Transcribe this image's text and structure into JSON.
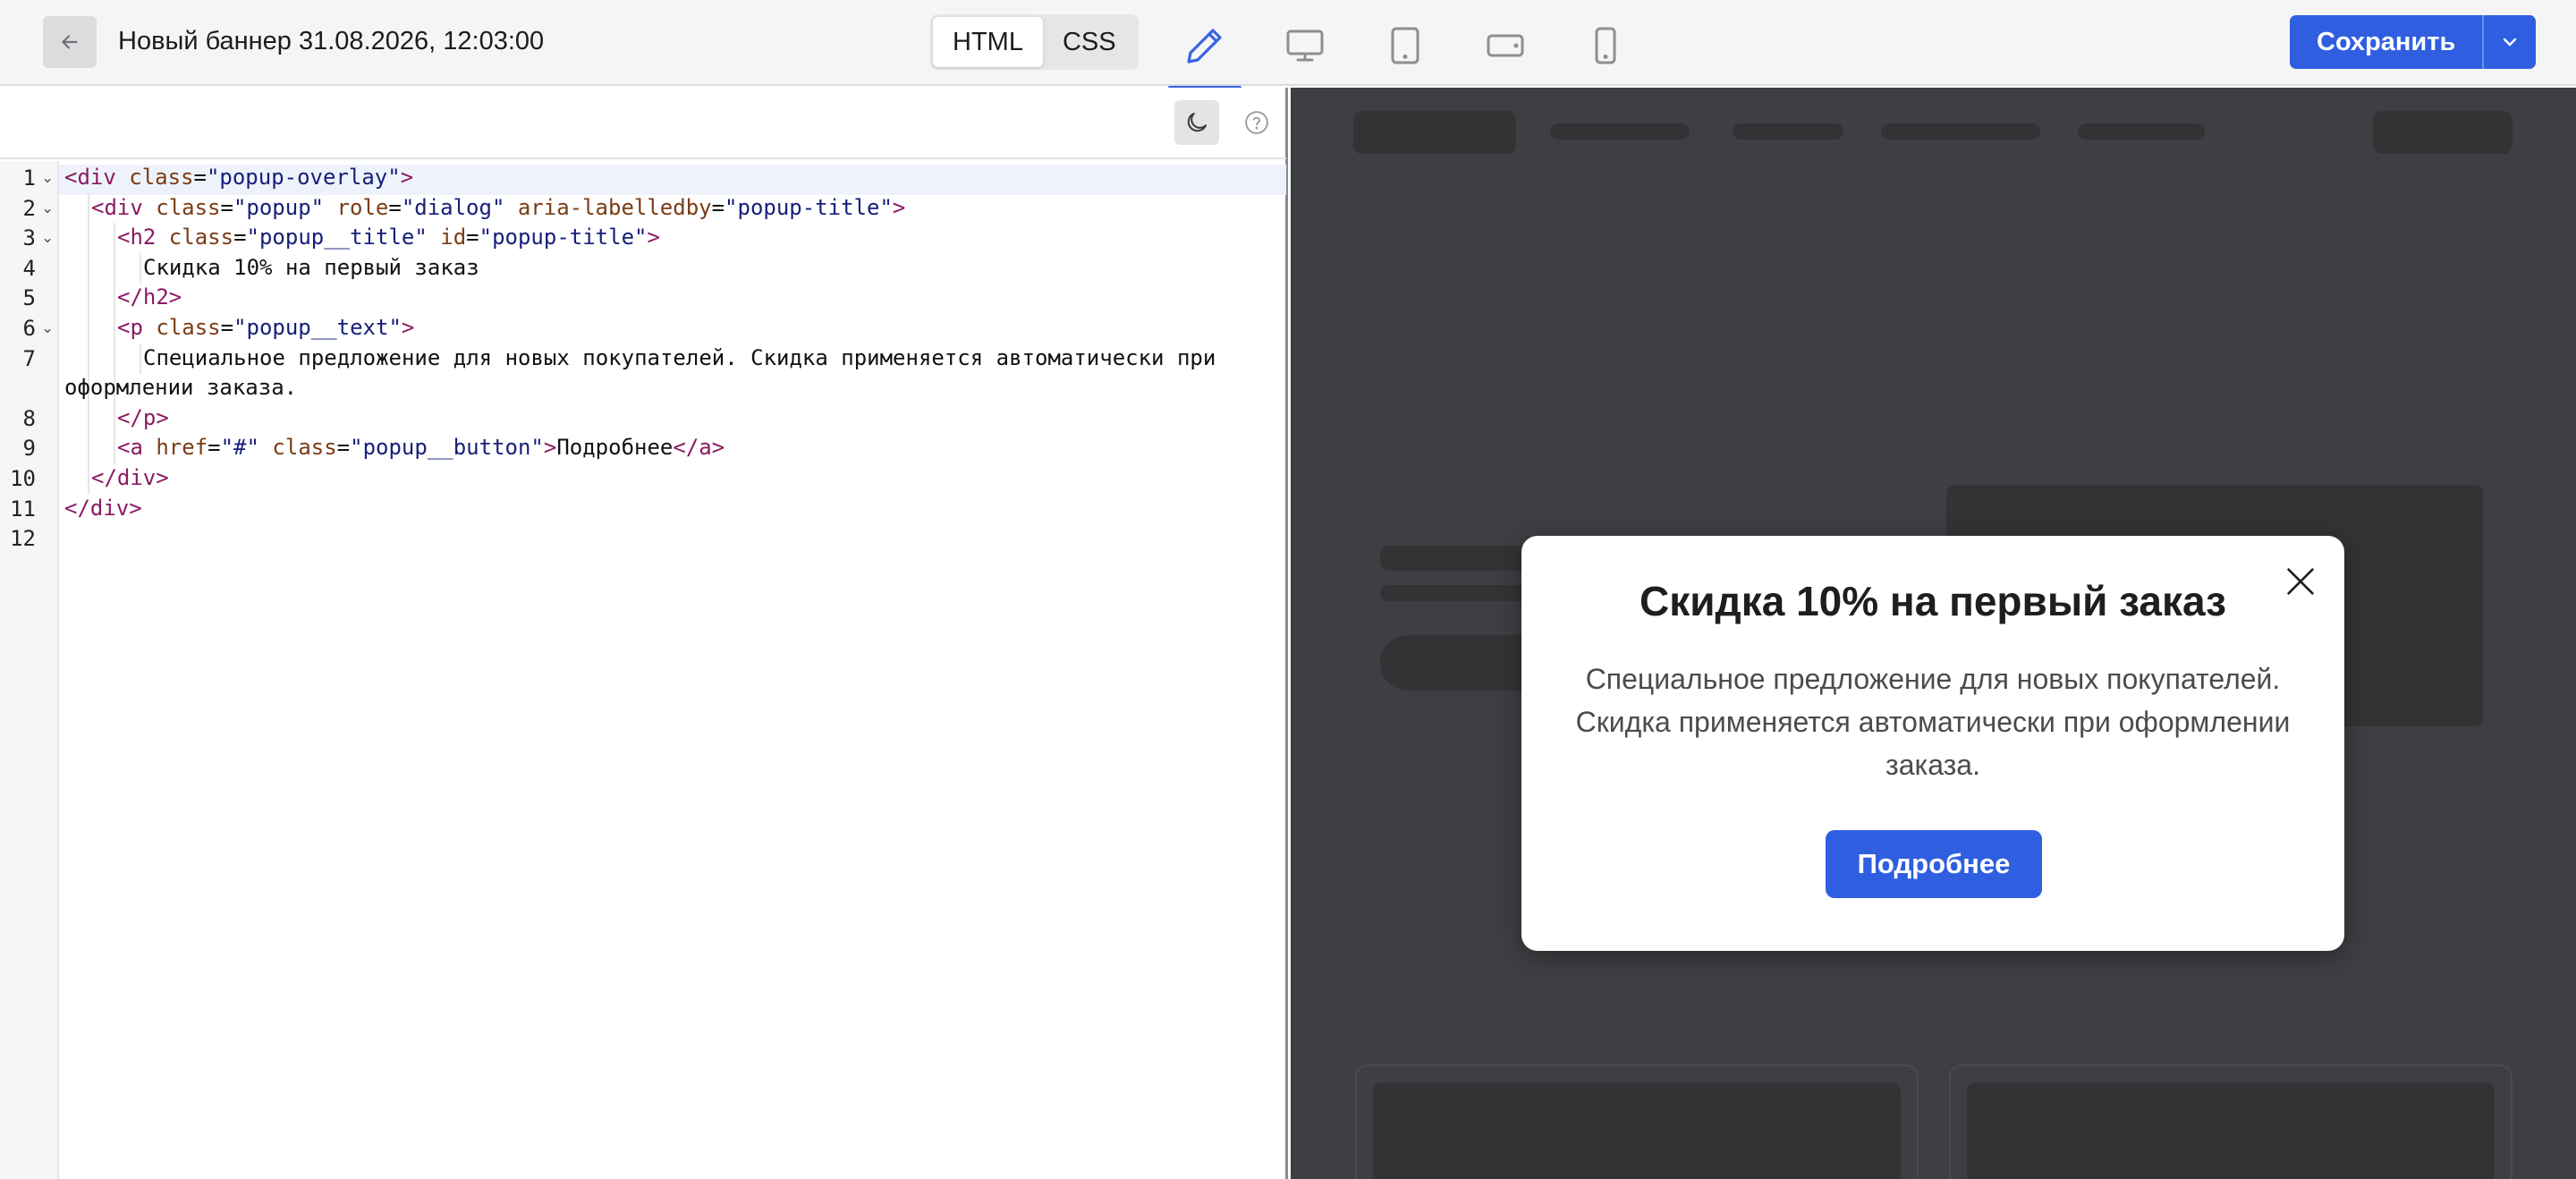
{
  "header": {
    "back_icon": "arrow-left-icon",
    "title": "Новый баннер 31.08.2026, 12:03:00",
    "tabs": [
      {
        "label": "HTML",
        "active": true
      },
      {
        "label": "CSS",
        "active": false
      }
    ],
    "modes": [
      {
        "name": "edit",
        "icon": "pencil-icon",
        "active": true
      },
      {
        "name": "desktop",
        "icon": "monitor-icon",
        "active": false
      },
      {
        "name": "tablet",
        "icon": "tablet-icon",
        "active": false
      },
      {
        "name": "tablet-landscape",
        "icon": "tablet-landscape-icon",
        "active": false
      },
      {
        "name": "mobile",
        "icon": "phone-icon",
        "active": false
      }
    ],
    "save_label": "Сохранить",
    "save_menu_icon": "chevron-down-icon"
  },
  "editor": {
    "theme_icon": "moon-icon",
    "help_icon": "question-circle-icon",
    "line_numbers": [
      "1",
      "2",
      "3",
      "4",
      "5",
      "6",
      "7",
      "8",
      "9",
      "10",
      "11",
      "12"
    ],
    "code": {
      "l1_tag": "<div",
      "l1_attr": " class",
      "l1_eq": "=",
      "l1_val": "\"popup-overlay\"",
      "l1_close": ">",
      "l2_tag": "<div",
      "l2_attr1": " class",
      "l2_val1": "\"popup\"",
      "l2_attr2": " role",
      "l2_val2": "\"dialog\"",
      "l2_attr3": " aria-labelledby",
      "l2_val3": "\"popup-title\"",
      "l2_close": ">",
      "l3_tag": "<h2",
      "l3_attr1": " class",
      "l3_val1": "\"popup__title\"",
      "l3_attr2": " id",
      "l3_val2": "\"popup-title\"",
      "l3_close": ">",
      "l4_text": "Скидка 10% на первый заказ",
      "l5_tag": "</h2>",
      "l6_tag": "<p",
      "l6_attr": " class",
      "l6_val": "\"popup__text\"",
      "l6_close": ">",
      "l7_text_a": "Специальное предложение для новых покупателей. Скидка применяется автоматически при",
      "l7_text_b": "оформлении заказа.",
      "l8_tag": "</p>",
      "l9_tag": "<a",
      "l9_attr1": " href",
      "l9_val1": "\"#\"",
      "l9_attr2": " class",
      "l9_val2": "\"popup__button\"",
      "l9_close": ">",
      "l9_text": "Подробнее",
      "l9_end": "</a>",
      "l10_tag": "</div>",
      "l11_tag": "</div>"
    }
  },
  "preview": {
    "popup": {
      "title": "Скидка 10% на первый заказ",
      "text": "Специальное предложение для новых покупателей. Скидка применяется автоматически при оформлении заказа.",
      "button": "Подробнее",
      "close_icon": "close-icon"
    }
  },
  "colors": {
    "accent": "#2f5fe0",
    "overlay": "#3e3f42",
    "tag": "#8a1a63",
    "attr": "#7a3c15",
    "value": "#16207a"
  }
}
